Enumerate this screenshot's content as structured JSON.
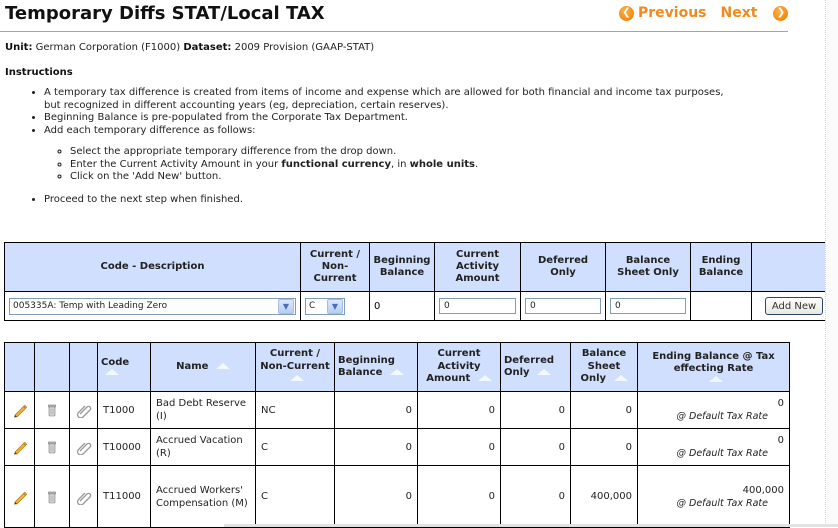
{
  "page": {
    "title": "Temporary Diffs STAT/Local TAX",
    "nav": {
      "previous_label": "Previous",
      "next_label": "Next",
      "accent_color": "#f08a1c"
    },
    "unit_label": "Unit:",
    "unit_value": "German Corporation (F1000)",
    "dataset_label": "Dataset:",
    "dataset_value": "2009 Provision (GAAP-STAT)"
  },
  "instructions": {
    "heading": "Instructions",
    "bullets": [
      "A temporary tax difference is created from items of income and expense which are allowed for both financial and income tax purposes, but recognized in different accounting years (eg, depreciation, certain reserves).",
      "Beginning Balance is pre-populated from the Corporate Tax Department.",
      "Add each temporary difference as follows:",
      "Proceed to the next step when finished."
    ],
    "sub_bullets": {
      "s1": "Select the appropriate temporary difference from the drop down.",
      "s2_pre": "Enter the Current Activity Amount in your ",
      "s2_bold1": "functional currency",
      "s2_mid": ", in ",
      "s2_bold2": "whole units",
      "s2_post": ".",
      "s3": "Click on the 'Add New' button."
    }
  },
  "add_form": {
    "headers": [
      "Code - Description",
      "Current / Non-Current",
      "Beginning Balance",
      "Current Activity Amount",
      "Deferred Only",
      "Balance Sheet Only",
      "Ending Balance",
      ""
    ],
    "code_select_value": "005335A: Temp with Leading Zero",
    "current_select_value": "C",
    "beginning_balance": "0",
    "current_activity_value": "0",
    "deferred_only_value": "0",
    "balance_sheet_only_value": "0",
    "ending_balance": "",
    "add_button_label": "Add New",
    "header_bg": "#cfdffd"
  },
  "list": {
    "headers": {
      "code": "Code",
      "name": "Name",
      "current": "Current / Non-Current",
      "beginning": "Beginning Balance",
      "activity": "Current Activity Amount",
      "deferred": "Deferred Only",
      "balance_sheet": "Balance Sheet Only",
      "ending": "Ending Balance @ Tax effecting Rate"
    },
    "rows": [
      {
        "code": "T1000",
        "name": "Bad Debt Reserve (I)",
        "current": "NC",
        "beginning": "0",
        "activity": "0",
        "deferred": "0",
        "balance_sheet": "0",
        "ending": "0",
        "rate": "@ Default Tax Rate"
      },
      {
        "code": "T10000",
        "name": "Accrued Vacation (R)",
        "current": "C",
        "beginning": "0",
        "activity": "0",
        "deferred": "0",
        "balance_sheet": "0",
        "ending": "0",
        "rate": "@ Default Tax Rate"
      },
      {
        "code": "T11000",
        "name": "Accrued Workers' Compensation (M)",
        "current": "C",
        "beginning": "0",
        "activity": "0",
        "deferred": "0",
        "balance_sheet": "400,000",
        "ending": "400,000",
        "rate": "@ Default Tax Rate"
      }
    ],
    "row_icons": [
      "pencil-edit-icon",
      "trash-can-icon",
      "paperclip-attach-icon"
    ]
  }
}
